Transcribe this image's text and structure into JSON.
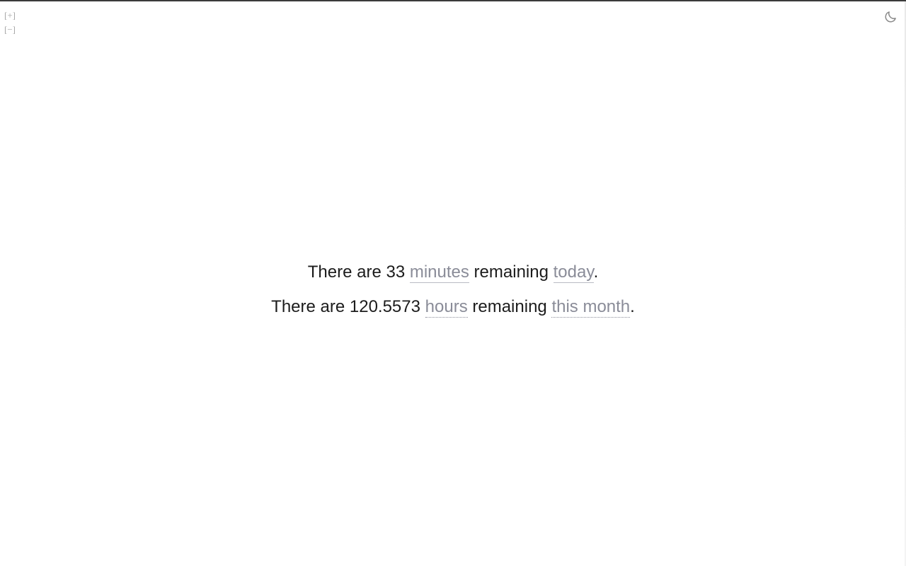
{
  "zoom": {
    "increase_label": "[+]",
    "decrease_label": "[−]"
  },
  "theme_toggle": {
    "icon": "moon-icon",
    "color": "#8a8a8a"
  },
  "sentences": [
    {
      "prefix": "There are 33 ",
      "unit": "minutes",
      "middle": " remaining ",
      "period": "today",
      "suffix": "."
    },
    {
      "prefix": "There are 120.5573 ",
      "unit": "hours",
      "middle": " remaining ",
      "period": "this month",
      "suffix": "."
    }
  ],
  "colors": {
    "text": "#1c1c1c",
    "option": "#8a8c98",
    "background": "#ffffff"
  }
}
